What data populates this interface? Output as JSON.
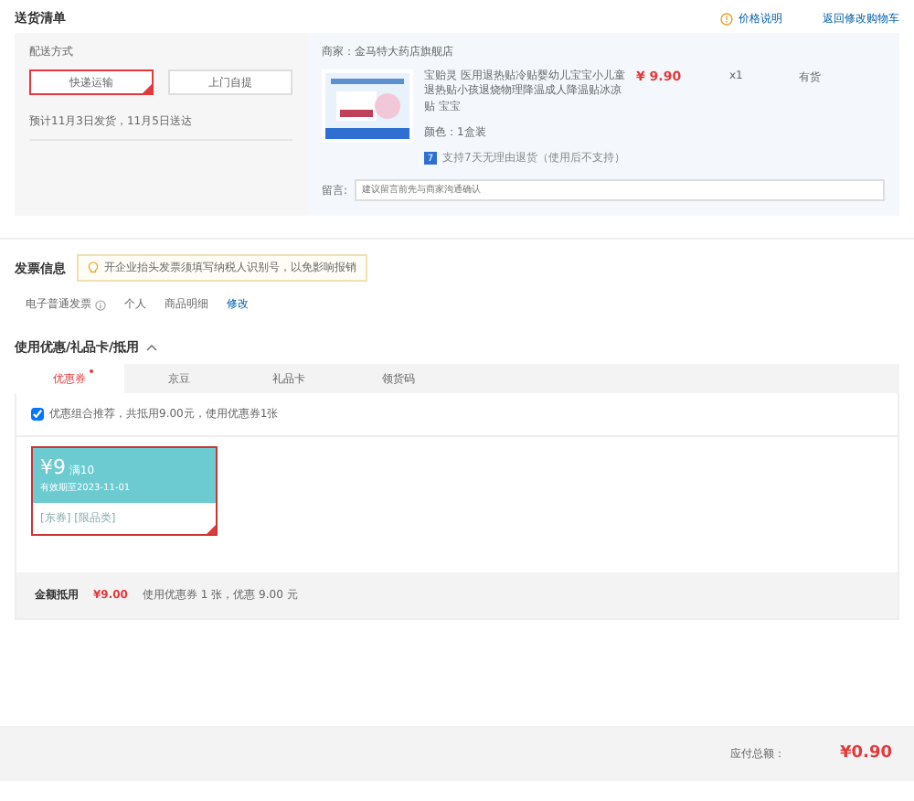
{
  "header": {
    "title": "送货清单",
    "price_note": "价格说明",
    "back_link": "返回修改购物车"
  },
  "delivery": {
    "label": "配送方式",
    "options": [
      {
        "label": "快递运输",
        "selected": true
      },
      {
        "label": "上门自提",
        "selected": false
      }
    ],
    "estimate": "预计11月3日发货，11月5日送达"
  },
  "shop": {
    "seller": "商家：金马特大药店旗舰店",
    "product": {
      "title": "宝贻灵 医用退热贴冷贴婴幼儿宝宝小儿童退热贴小孩退烧物理降温成人降温贴冰凉贴 宝宝",
      "price": "¥ 9.90",
      "quantity": "x1",
      "stock": "有货",
      "spec": "颜色：1盒装",
      "return_badge": "7",
      "return_policy": "支持7天无理由退货（使用后不支持）"
    },
    "note_label": "留言:",
    "note_placeholder": "建议留言前先与商家沟通确认"
  },
  "invoice": {
    "title": "发票信息",
    "tip": "开企业抬头发票须填写纳税人识别号，以免影响报销",
    "type": "电子普通发票",
    "holder": "个人",
    "content": "商品明细",
    "edit": "修改"
  },
  "discount": {
    "title": "使用优惠/礼品卡/抵用",
    "expanded": true,
    "tabs": [
      {
        "label": "优惠券",
        "selected": true
      },
      {
        "label": "京豆",
        "selected": false
      },
      {
        "label": "礼品卡",
        "selected": false
      },
      {
        "label": "领货码",
        "selected": false
      }
    ],
    "recommend": {
      "checked": true,
      "text": "优惠组合推荐，共抵用9.00元，使用优惠券1张"
    },
    "coupons": [
      {
        "amount": "¥9",
        "condition": "满10",
        "validity": "有效期至2023-11-01",
        "tags": "[东券] [限品类]",
        "selected": true
      }
    ],
    "summary_label": "金额抵用",
    "summary_amount": "¥9.00",
    "summary_text": "使用优惠券 1 张，优惠 9.00 元"
  },
  "total": {
    "label": "应付总额：",
    "amount": "¥0.90"
  }
}
